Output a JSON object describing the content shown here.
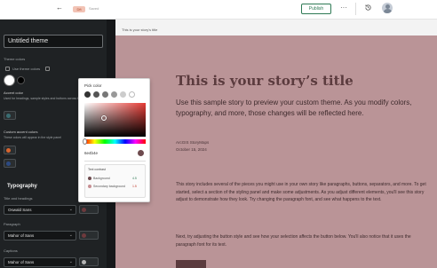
{
  "topbar": {
    "back_glyph": "←",
    "doc_badge": "Dft",
    "status": "Saved",
    "publish_label": "Publish",
    "more_glyph": "···",
    "history_icon": "history-icon",
    "avatar_icon": "user-avatar"
  },
  "sidebar": {
    "theme_name": "Untitled theme",
    "theme_color_label": "Theme colors",
    "use_theme_colors_label": "Use theme colors",
    "accent_label": "Accent color",
    "accent_desc": "Used for headings, sample styles and buttons across the story",
    "custom_accent_label": "Custom accent colors",
    "custom_accent_desc": "These colors will appear in the style panel",
    "typography_label": "Typography",
    "title_heading_label": "Title and headings",
    "title_font": "Oswald Sans",
    "paragraph_label": "Paragraph",
    "paragraph_font": "Mahor of Sans",
    "captions_label": "Captions",
    "captions_font": "Mahor of Sans",
    "chevron": "⌄",
    "swatches": {
      "white": "#ffffff",
      "black": "#000000",
      "teal": "#3a6d72",
      "orange": "#d8652f",
      "navy": "#2c4a82",
      "maroon": "#6e3a3d",
      "gray": "#b5b5b5"
    }
  },
  "canvas": {
    "label": "This is your story's title"
  },
  "preview": {
    "bg_color": "#ba9497",
    "title": "This is your story’s title",
    "subtitle": "Use this sample story to preview your custom theme. As you modify colors, typography, and more, those changes will be reflected here.",
    "byline": "ArcGIS StoryMaps",
    "date": "October 15, 2024",
    "body1": "This story includes several of the pieces you might use in your own story like paragraphs, buttons, separators, and more. To get started, select a section of the styling panel and make some adjustments. As you adjust different elements, you'll see this story adjust to demonstrate how they look. Try changing the paragraph font, and see what happens to the text.",
    "body2": "Next, try adjusting the button style and see how your selection affects the button below. You'll also notice that it uses the paragraph font for its text."
  },
  "picker": {
    "title": "Pick color",
    "presets": [
      "#333333",
      "#555555",
      "#777777",
      "#999999",
      "#cccccc",
      "#ffffff"
    ],
    "hex_value": "#6e4b4e",
    "hex_display": "6e4b4e",
    "contrast_title": "Text contrast",
    "contrast_rows": [
      {
        "label": "Background",
        "color": "#6e4b4e",
        "score": "4.5",
        "status": "pass"
      },
      {
        "label": "Secondary background",
        "color": "#c78f93",
        "score": "1.5",
        "status": "fail"
      }
    ]
  }
}
